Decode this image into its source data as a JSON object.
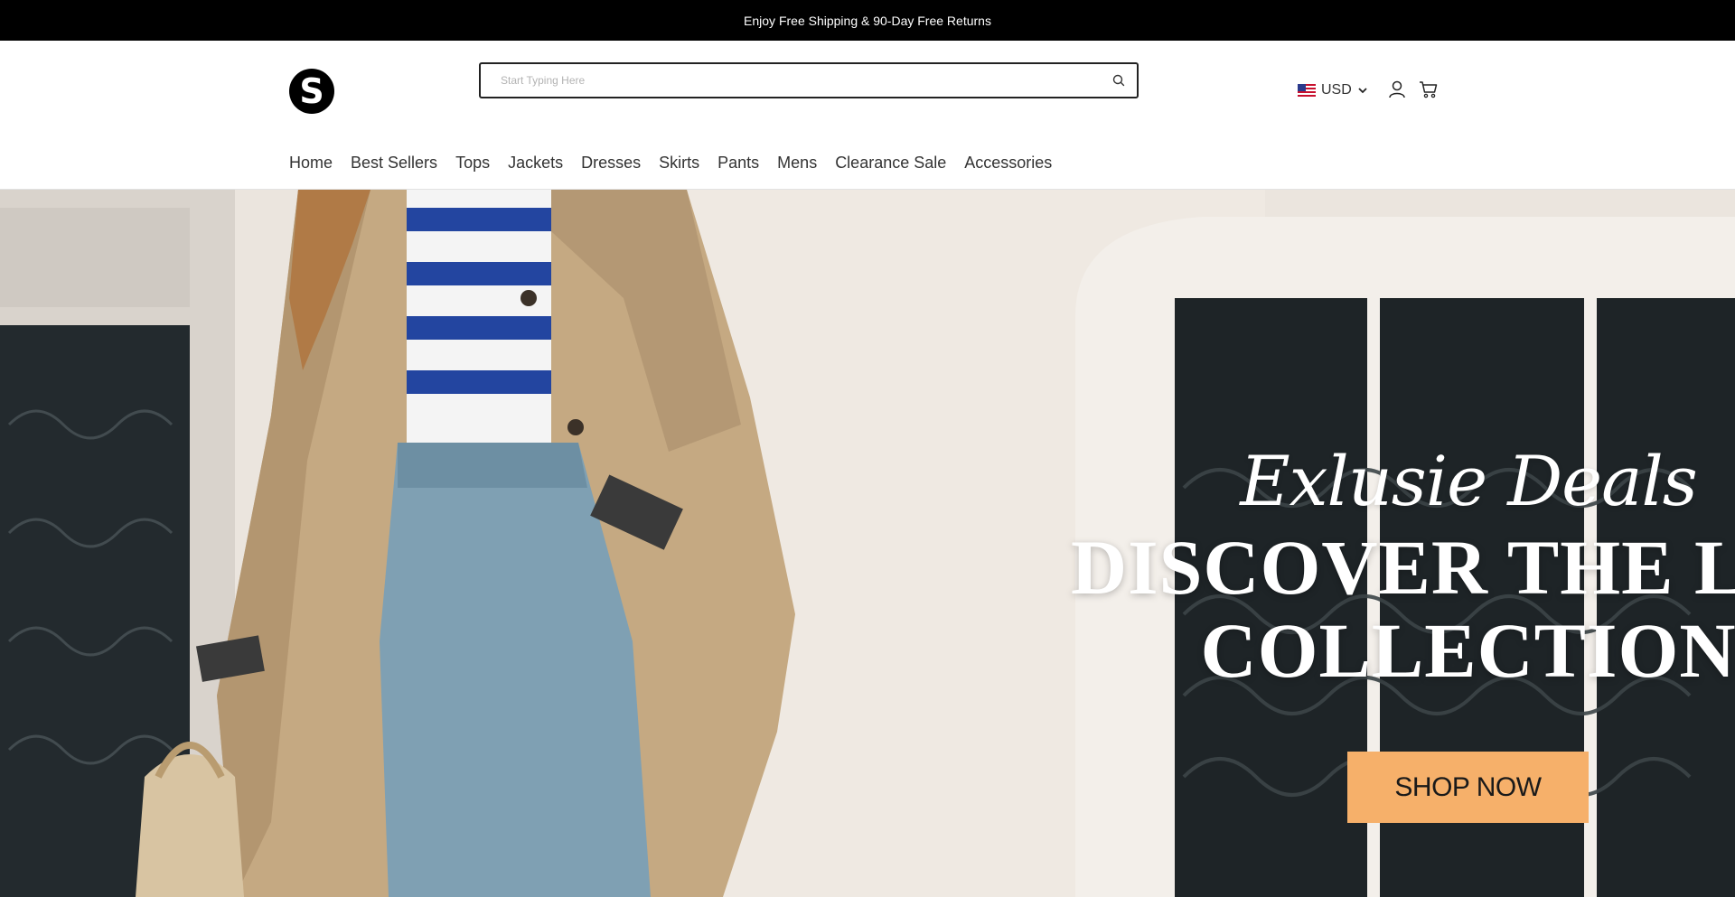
{
  "announcement": {
    "text": "Enjoy Free Shipping & 90-Day Free Returns"
  },
  "header": {
    "logo_letter": "S",
    "search": {
      "placeholder": "Start Typing Here",
      "value": ""
    },
    "currency": {
      "code": "USD",
      "flag": "us-flag-icon"
    },
    "icons": [
      "search-icon",
      "user-icon",
      "cart-icon",
      "chevron-down-icon"
    ]
  },
  "nav": {
    "items": [
      {
        "label": "Home"
      },
      {
        "label": "Best Sellers"
      },
      {
        "label": "Tops"
      },
      {
        "label": "Jackets"
      },
      {
        "label": "Dresses"
      },
      {
        "label": "Skirts"
      },
      {
        "label": "Pants"
      },
      {
        "label": "Mens"
      },
      {
        "label": "Clearance Sale"
      },
      {
        "label": "Accessories"
      }
    ]
  },
  "hero": {
    "script_title": "Exlusie Deals",
    "headline_line1": "DISCOVER THE LAT",
    "headline_line2": "COLLECTION",
    "cta_label": "SHOP NOW"
  },
  "colors": {
    "announcement_bg": "#000000",
    "cta_bg": "#f6b06a",
    "text": "#222222"
  }
}
